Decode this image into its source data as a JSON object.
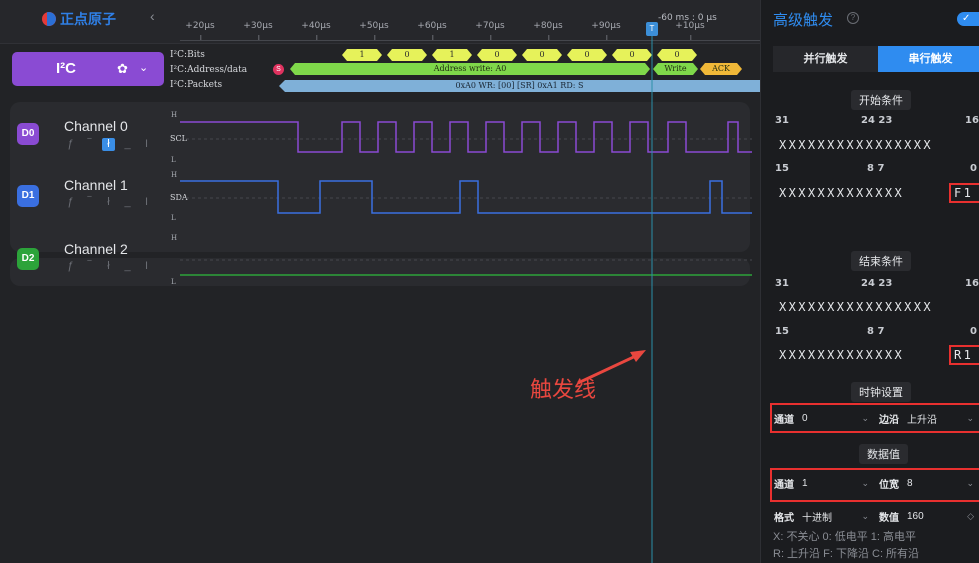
{
  "app": {
    "logo_text": "正点原子",
    "collapse": "‹"
  },
  "ruler": {
    "ticks": [
      "+20µs",
      "+30µs",
      "+40µs",
      "+50µs",
      "+60µs",
      "+70µs",
      "+80µs",
      "+90µs",
      "+10µs"
    ],
    "trigger_time": "-60 ms : 0 µs",
    "trigger_flag": "T"
  },
  "protocol": {
    "name": "I²C",
    "rows": [
      "I²C:Bits",
      "I²C:Address/data",
      "I²C:Packets"
    ],
    "start_marker": "S",
    "bits": [
      "1",
      "0",
      "1",
      "0",
      "0",
      "0",
      "0",
      "0"
    ],
    "address_text": "Address write: A0",
    "write_text": "Write",
    "ack_text": "ACK",
    "packet_text": "0xA0 WR: [00] [SR] 0xA1 RD: S"
  },
  "channels": [
    {
      "badge": "D0",
      "name": "Channel 0",
      "signal": "SCL",
      "color": "#8a4bd3"
    },
    {
      "badge": "D1",
      "name": "Channel 1",
      "signal": "SDA",
      "color": "#3a6fe0"
    },
    {
      "badge": "D2",
      "name": "Channel 2",
      "signal": "",
      "color": "#2ca33a"
    }
  ],
  "trigger_glyphs": [
    "ƒ",
    "‾",
    "ł",
    "_",
    "I"
  ],
  "level_labels": {
    "high": "H",
    "low": "L"
  },
  "annotation": "触发线",
  "panel": {
    "title": "高级触发",
    "help": "?",
    "tabs": [
      "并行触发",
      "串行触发"
    ],
    "start_section": "开始条件",
    "end_section": "结束条件",
    "clock_section": "时钟设置",
    "data_section": "数据值",
    "bits_hi": [
      "31",
      "24 23",
      "16"
    ],
    "bits_lo": [
      "15",
      "8 7",
      "0"
    ],
    "x_row": "XXXXXXXXXXXXXXXX",
    "start_lo_row": "XXXXXXXXXXXXX",
    "start_lo_tail": "F1",
    "end_lo_row": "XXXXXXXXXXXXX",
    "end_lo_tail": "R1",
    "clock": {
      "channel_label": "通道",
      "channel_value": "0",
      "edge_label": "边沿",
      "edge_value": "上升沿"
    },
    "data": {
      "channel_label": "通道",
      "channel_value": "1",
      "width_label": "位宽",
      "width_value": "8",
      "format_label": "格式",
      "format_value": "十进制",
      "value_label": "数值",
      "value_value": "160"
    },
    "legend_line1": "X: 不关心   0: 低电平   1: 高电平",
    "legend_line2": "R: 上升沿   F: 下降沿   C: 所有沿"
  }
}
